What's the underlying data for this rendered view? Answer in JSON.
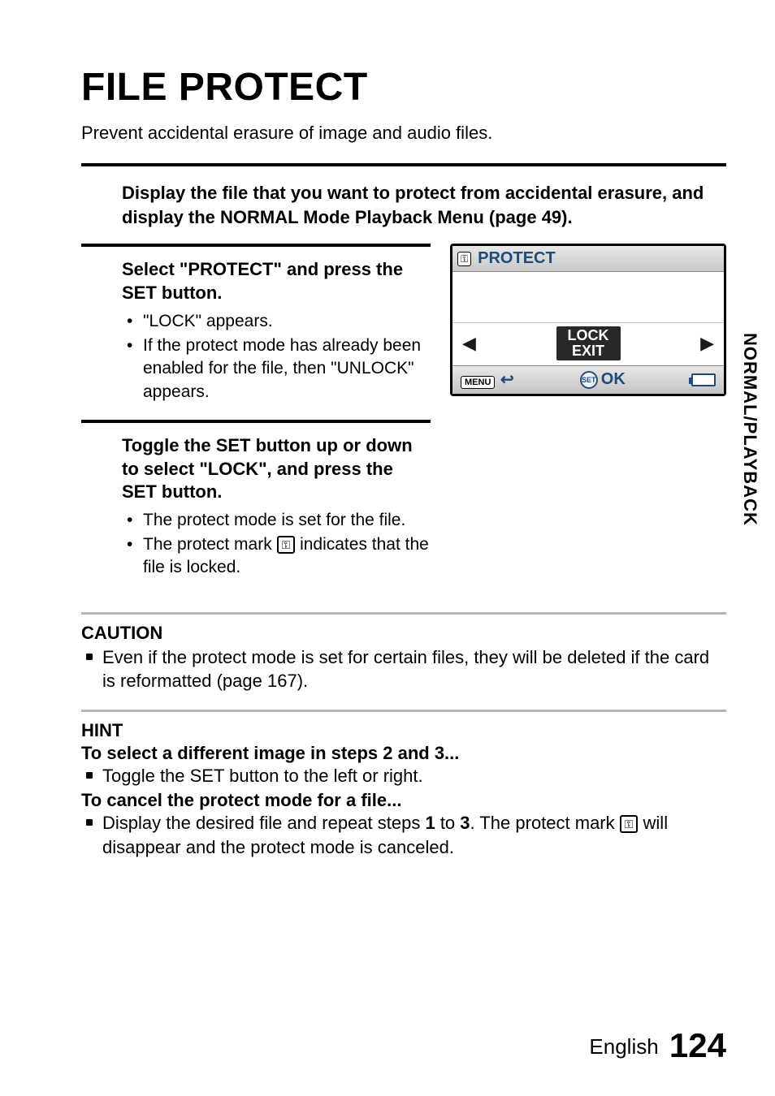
{
  "side_tab": "NORMAL/PLAYBACK",
  "title": "FILE PROTECT",
  "intro": "Prevent accidental erasure of image and audio files.",
  "step1": "Display the file that you want to protect from accidental erasure, and display the NORMAL Mode Playback Menu (page 49).",
  "step2": {
    "head": "Select \"PROTECT\" and press the SET button.",
    "b1": "\"LOCK\" appears.",
    "b2": "If the protect mode has already been enabled for the file, then \"UNLOCK\" appears."
  },
  "step3": {
    "head": "Toggle the SET button up or down to select \"LOCK\", and press the SET button.",
    "b1": "The protect mode is set for the file.",
    "b2_a": "The protect mark ",
    "b2_b": " indicates that the file is locked."
  },
  "osd": {
    "title": "PROTECT",
    "lock": "LOCK",
    "exit": "EXIT",
    "menu": "MENU",
    "set": "SET",
    "ok": "OK",
    "left": "◀",
    "right": "▶",
    "return": "↩"
  },
  "caution": {
    "head": "CAUTION",
    "b1": "Even if the protect mode is set for certain files, they will be deleted if the card is reformatted (page 167)."
  },
  "hint": {
    "head": "HINT",
    "sub1": "To select a different image in steps 2 and 3...",
    "sub1_b1": "Toggle the SET button to the left or right.",
    "sub2": "To cancel the protect mode for a file...",
    "sub2_b1_a": "Display the desired file and repeat steps ",
    "sub2_b1_bold1": "1",
    "sub2_b1_mid": " to ",
    "sub2_b1_bold2": "3",
    "sub2_b1_b": ". The protect mark ",
    "sub2_b1_c": " will disappear and the protect mode is canceled."
  },
  "footer": {
    "lang": "English",
    "page": "124"
  },
  "icons": {
    "key": "⚿"
  }
}
